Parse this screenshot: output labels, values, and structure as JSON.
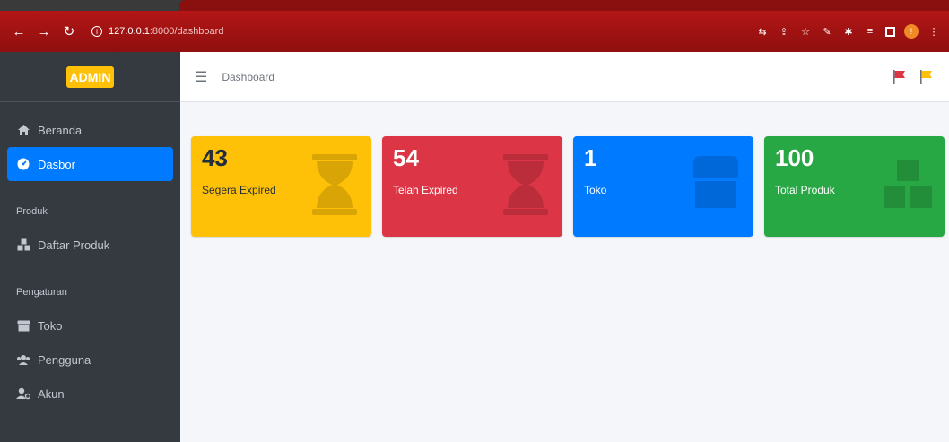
{
  "browser": {
    "url_host": "127.0.0.1",
    "url_path": ":8000/dashboard",
    "profile_initial": "!"
  },
  "sidebar": {
    "brand": "ADMIN",
    "items_main": [
      {
        "label": "Beranda",
        "icon": "home-icon"
      },
      {
        "label": "Dasbor",
        "icon": "dashboard-icon",
        "active": true
      }
    ],
    "section_produk": "Produk",
    "items_produk": [
      {
        "label": "Daftar Produk",
        "icon": "boxes-icon"
      }
    ],
    "section_pengaturan": "Pengaturan",
    "items_pengaturan": [
      {
        "label": "Toko",
        "icon": "store-icon"
      },
      {
        "label": "Pengguna",
        "icon": "users-icon"
      },
      {
        "label": "Akun",
        "icon": "user-cog-icon"
      }
    ]
  },
  "navbar": {
    "title": "Dashboard"
  },
  "stats": [
    {
      "value": "43",
      "label": "Segera Expired",
      "color": "#ffc107",
      "icon": "hourglass-icon"
    },
    {
      "value": "54",
      "label": "Telah Expired",
      "color": "#dc3545",
      "icon": "hourglass-end-icon"
    },
    {
      "value": "1",
      "label": "Toko",
      "color": "#007bff",
      "icon": "store-icon"
    },
    {
      "value": "100",
      "label": "Total Produk",
      "color": "#28a745",
      "icon": "boxes-icon"
    }
  ]
}
